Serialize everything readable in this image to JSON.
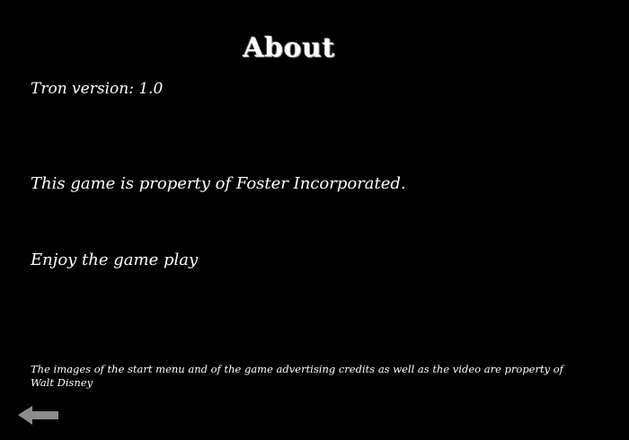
{
  "page": {
    "title": "About",
    "version_text": "Tron version: 1.0",
    "property_text": "This game is property of Foster Incorporated.",
    "enjoy_text": "Enjoy the game play",
    "credits_text": "The images of the start menu and of the game advertising credits as well as the video are property of Walt Disney"
  },
  "navigation": {
    "back_icon": "left-arrow-icon",
    "back_color": "#8c8c8c"
  },
  "colors": {
    "background": "#000000",
    "text": "#ffffff"
  }
}
